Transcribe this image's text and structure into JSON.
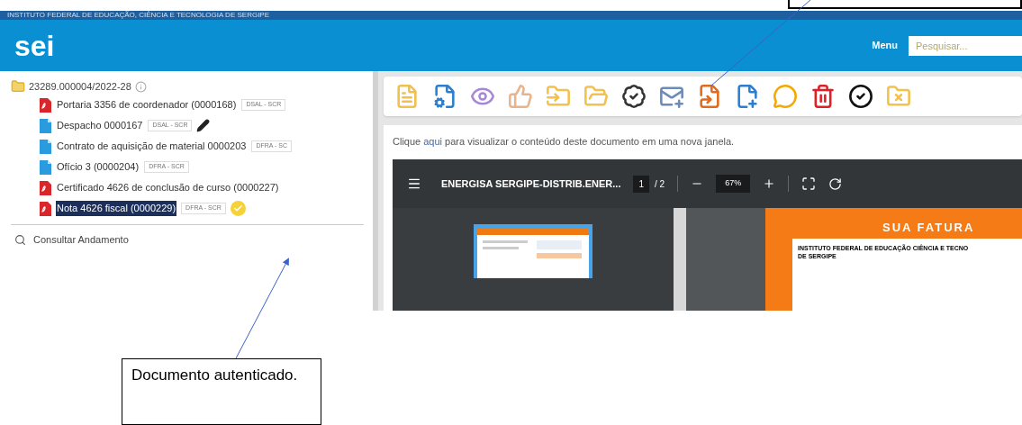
{
  "header": {
    "institution": "INSTITUTO FEDERAL DE EDUCAÇÃO, CIÊNCIA E TECNOLOGIA DE SERGIPE",
    "logo": "sei",
    "menu": "Menu",
    "search": {
      "placeholder": "Pesquisar..."
    }
  },
  "tree": {
    "root": "23289.000004/2022-28",
    "children": [
      {
        "kind": "pdf",
        "label": "Portaria 3356 de coordenador (0000168)",
        "tag": "DSAL - SCR",
        "selected": false,
        "pen": false,
        "authenticated": false
      },
      {
        "kind": "doc",
        "label": "Despacho 0000167",
        "tag": "DSAL - SCR",
        "selected": false,
        "pen": true,
        "authenticated": false
      },
      {
        "kind": "doc",
        "label": "Contrato de aquisição de material 0000203",
        "tag": "DFRA - SC",
        "selected": false,
        "pen": false,
        "authenticated": false
      },
      {
        "kind": "doc",
        "label": "Ofício 3 (0000204)",
        "tag": "DFRA - SCR",
        "selected": false,
        "pen": false,
        "authenticated": false
      },
      {
        "kind": "pdf",
        "label": "Certificado 4626 de conclusão de curso (0000227)",
        "selected": false,
        "pen": false,
        "authenticated": false
      },
      {
        "kind": "pdf",
        "label": "Nota 4626 fiscal (0000229)",
        "tag": "DFRA - SCR",
        "selected": true,
        "pen": false,
        "authenticated": true
      }
    ]
  },
  "left_menu": [
    "Consultar Andamento"
  ],
  "content": {
    "intro": {
      "before": "Clique ",
      "link": "aqui",
      "after": " para visualizar o conteúdo deste documento em uma nova janela."
    }
  },
  "pdf_viewer": {
    "title": "ENERGISA SERGIPE-DISTRIB.ENER...",
    "page": "1",
    "pages": "/ 2",
    "zoom": "67%",
    "page_heading": "SUA FATURA",
    "page_lines": [
      "INSTITUTO FEDERAL DE EDUCAÇÃO CIÊNCIA E TECNO",
      "DE SERGIPE"
    ]
  },
  "callouts": [
    {
      "text": "Documento autenticado."
    }
  ]
}
